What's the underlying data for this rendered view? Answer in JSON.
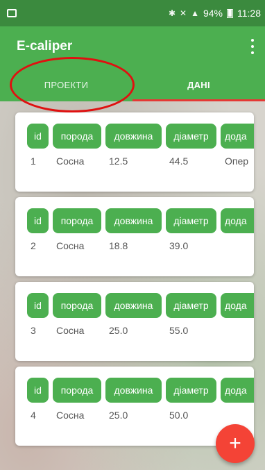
{
  "status_bar": {
    "battery": "94%",
    "time": "11:28"
  },
  "app": {
    "title": "E-caliper"
  },
  "tabs": [
    {
      "label": "ПРОЕКТИ"
    },
    {
      "label": "ДАНІ"
    }
  ],
  "columns": {
    "id": "id",
    "poroda": "порода",
    "dovzhyna": "довжина",
    "diametr": "діаметр",
    "dod": "дода"
  },
  "rows": [
    {
      "id": "1",
      "poroda": "Сосна",
      "dovzhyna": "12.5",
      "diametr": "44.5",
      "dod": "Опер"
    },
    {
      "id": "2",
      "poroda": "Сосна",
      "dovzhyna": "18.8",
      "diametr": "39.0",
      "dod": ""
    },
    {
      "id": "3",
      "poroda": "Сосна",
      "dovzhyna": "25.0",
      "diametr": "55.0",
      "dod": ""
    },
    {
      "id": "4",
      "poroda": "Сосна",
      "dovzhyna": "25.0",
      "diametr": "50.0",
      "dod": ""
    }
  ],
  "fab": {
    "label": "+"
  },
  "colors": {
    "primary": "#4caf50",
    "primary_dark": "#3b8a3e",
    "accent": "#f44336",
    "annotation": "#e01010"
  },
  "icons": {
    "overflow": "more-vert-icon",
    "fab": "add-icon"
  }
}
